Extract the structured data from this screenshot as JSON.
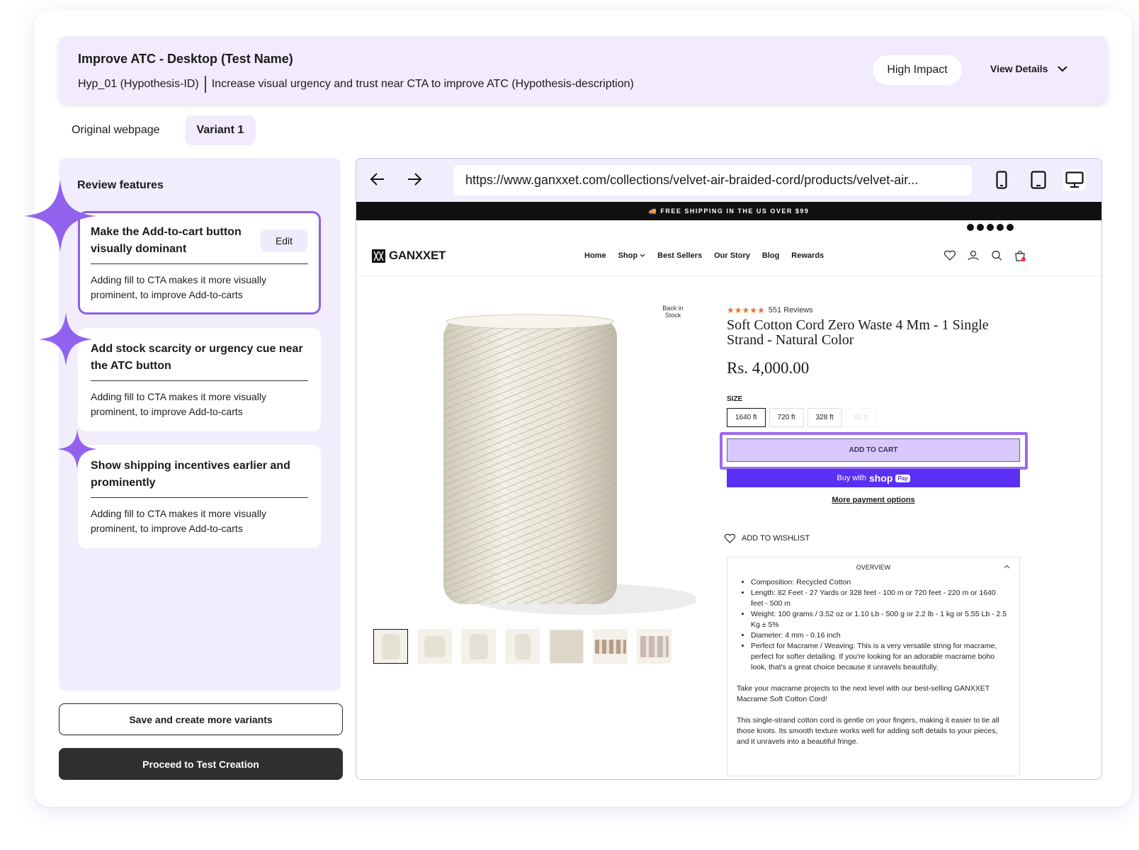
{
  "header": {
    "title": "Improve ATC - Desktop (Test Name)",
    "hypothesis_id": "Hyp_01 (Hypothesis-ID)",
    "hypothesis_desc": "Increase visual urgency and trust near CTA to improve ATC (Hypothesis-description)",
    "impact": "High Impact",
    "view_details": "View Details"
  },
  "tabs": [
    "Original webpage",
    "Variant 1"
  ],
  "panel": {
    "title": "Review features",
    "features": [
      {
        "title": "Make the Add-to-cart button visually dominant",
        "desc": "Adding fill to CTA makes it more visually prominent, to improve Add-to-carts",
        "edit": "Edit"
      },
      {
        "title": "Add stock scarcity or urgency cue near the ATC button",
        "desc": "Adding fill to CTA makes it more visually prominent, to improve Add-to-carts"
      },
      {
        "title": "Show shipping incentives earlier and prominently",
        "desc": "Adding fill to CTA makes it more visually prominent, to improve Add-to-carts"
      }
    ]
  },
  "actions": {
    "save": "Save and create more variants",
    "proceed": "Proceed to Test Creation"
  },
  "browser": {
    "url": "https://www.ganxxet.com/collections/velvet-air-braided-cord/products/velvet-air..."
  },
  "site": {
    "shipping_banner": "🚚 FREE SHIPPING IN THE US OVER $99",
    "logo": "GANXXET",
    "menu": [
      "Home",
      "Shop",
      "Best Sellers",
      "Our Story",
      "Blog",
      "Rewards"
    ],
    "back_in_stock": "Back in Stock",
    "reviews": "551 Reviews",
    "product_title": "Soft Cotton Cord Zero Waste 4 Mm - 1 Single Strand - Natural Color",
    "price": "Rs. 4,000.00",
    "size_label": "SIZE",
    "sizes": [
      "1640 ft",
      "720 ft",
      "328 ft",
      "82 ft"
    ],
    "add_to_cart": "ADD TO CART",
    "buy_with": "Buy with",
    "shop": "shop",
    "pay": "Pay",
    "more_payment": "More payment options",
    "wishlist": "ADD TO WISHLIST",
    "overview_title": "OVERVIEW",
    "overview_bullets": [
      "Composition: Recycled Cotton",
      "Length: 82 Feet - 27 Yards or 328 feet - 100 m or 720 feet - 220 m or 1640 feet - 500 m",
      "Weight: 100 grams / 3.52 oz or 1.10 Lb - 500 g or 2.2 lb - 1 kg or 5.55 Lb - 2.5 Kg ± 5%",
      "Diameter: 4 mm - 0.16 inch",
      "Perfect for Macrame / Weaving: This is a very versatile string for macrame, perfect for softer detailing. If you're looking for an adorable macrame boho look, that's a great choice because it unravels beautifully."
    ],
    "overview_p1": "Take your macrame projects to the next level with our best-selling GANXXET Macrame Soft Cotton Cord!",
    "overview_p2": "This single-strand cotton cord is gentle on your fingers, making it easier to tie all those knots. Its smooth texture works well for adding soft details to your pieces, and it unravels into a beautiful fringe."
  }
}
